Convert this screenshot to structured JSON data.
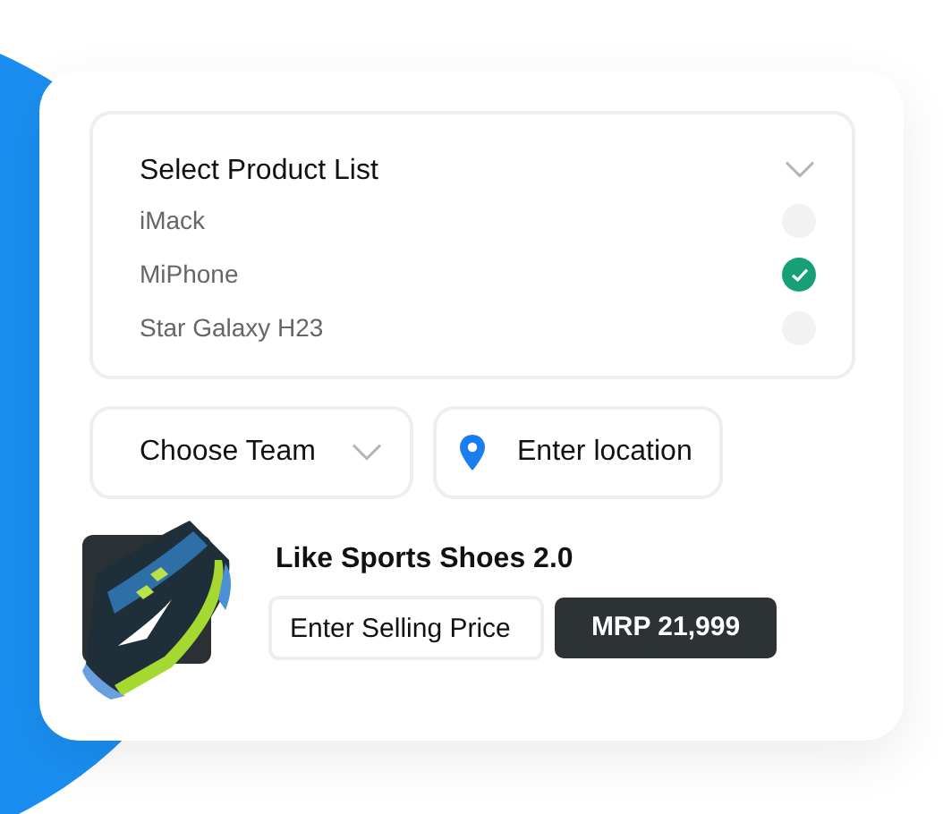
{
  "product_list": {
    "title": "Select Product List",
    "expanded": true,
    "items": [
      {
        "label": "iMack",
        "selected": false
      },
      {
        "label": "MiPhone",
        "selected": true
      },
      {
        "label": "Star Galaxy H23",
        "selected": false
      }
    ]
  },
  "team_select": {
    "placeholder": "Choose Team"
  },
  "location": {
    "placeholder": "Enter location"
  },
  "product": {
    "name": "Like Sports Shoes 2.0",
    "price": {
      "placeholder": "Enter Selling Price"
    },
    "mrp": "MRP 21,999"
  }
}
